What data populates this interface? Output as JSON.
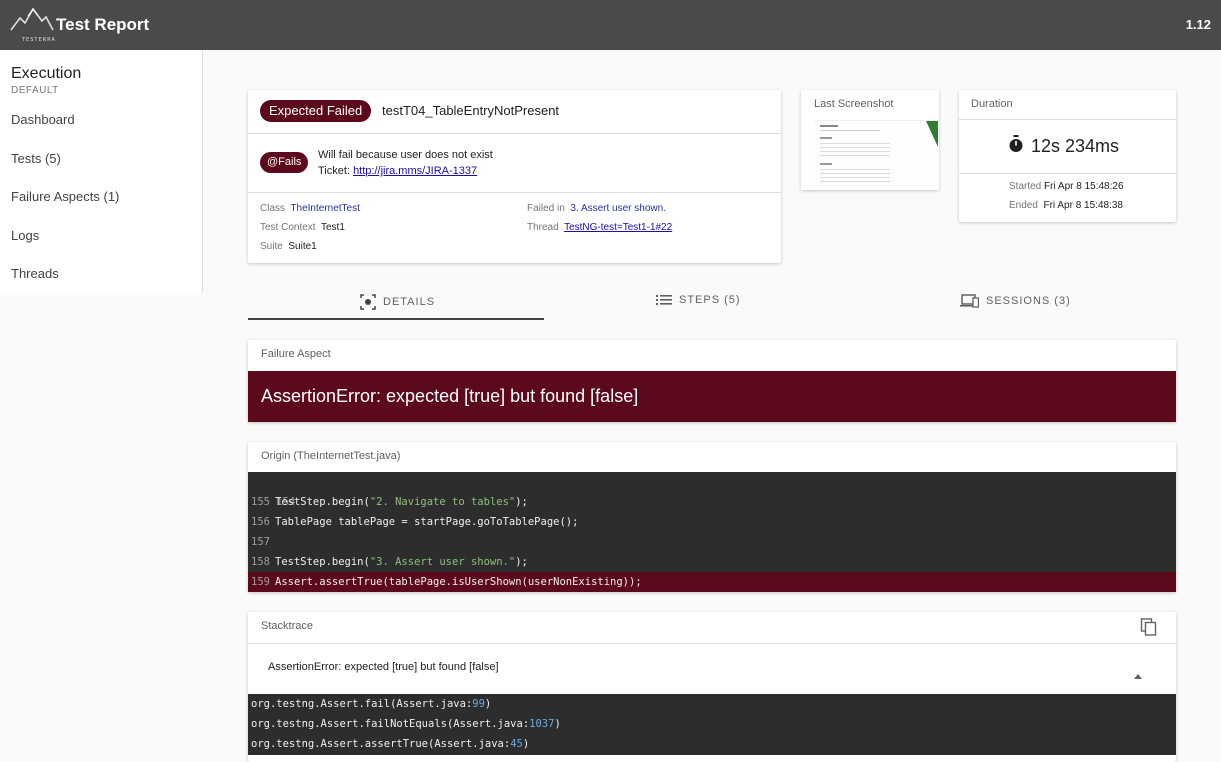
{
  "header": {
    "title": "Test Report",
    "logo_text": "TESTERRA",
    "version": "1.12"
  },
  "sidebar": {
    "title": "Execution",
    "subtitle": "DEFAULT",
    "items": [
      {
        "label": "Dashboard"
      },
      {
        "label": "Tests (5)"
      },
      {
        "label": "Failure Aspects (1)"
      },
      {
        "label": "Logs"
      },
      {
        "label": "Threads"
      }
    ]
  },
  "test": {
    "status_chip": "Expected Failed",
    "name": "testT04_TableEntryNotPresent",
    "fails_chip": "@Fails",
    "fails_description": "Will fail because user does not exist",
    "ticket_label": "Ticket:",
    "ticket_link": "http://jira.mms/JIRA-1337",
    "class_label": "Class",
    "class_value": "TheInternetTest",
    "context_label": "Test Context",
    "context_value": "Test1",
    "suite_label": "Suite",
    "suite_value": "Suite1",
    "failed_in_label": "Failed in",
    "failed_in_value": "3. Assert user shown.",
    "thread_label": "Thread",
    "thread_value": "TestNG-test=Test1-1#22"
  },
  "screenshot": {
    "label": "Last Screenshot"
  },
  "duration": {
    "label": "Duration",
    "value": "12s 234ms",
    "started_label": "Started",
    "started_value": "Fri Apr 8 15:48:26",
    "ended_label": "Ended",
    "ended_value": "Fri Apr 8 15:48:38"
  },
  "tabs": [
    {
      "label": "DETAILS",
      "icon": "details-icon",
      "active": true
    },
    {
      "label": "STEPS (5)",
      "icon": "list-icon",
      "active": false
    },
    {
      "label": "SESSIONS (3)",
      "icon": "devices-icon",
      "active": false
    }
  ],
  "failure_aspect": {
    "label": "Failure Aspect",
    "message": "AssertionError: expected [true] but found [false]",
    "accent_color": "#5c0a1b"
  },
  "origin": {
    "label": "Origin (TheInternetTest.java)",
    "lines": [
      {
        "num": "154",
        "pre": "",
        "str": "",
        "post": ""
      },
      {
        "num": "155",
        "pre": "TestStep.begin(",
        "str": "\"2. Navigate to tables\"",
        "post": ");"
      },
      {
        "num": "156",
        "pre": "TablePage tablePage = startPage.goToTablePage();",
        "str": "",
        "post": ""
      },
      {
        "num": "157",
        "pre": "",
        "str": "",
        "post": ""
      },
      {
        "num": "158",
        "pre": "TestStep.begin(",
        "str": "\"3. Assert user shown.\"",
        "post": ");"
      },
      {
        "num": "159",
        "pre": "Assert.assertTrue(tablePage.isUserShown(userNonExisting));",
        "str": "",
        "post": ""
      }
    ]
  },
  "stacktrace": {
    "label": "Stacktrace",
    "summary": "AssertionError: expected [true] but found [false]",
    "frames": [
      {
        "pre": "org.testng.Assert.fail(Assert.java:",
        "num": "99",
        "post": ")"
      },
      {
        "pre": "org.testng.Assert.failNotEquals(Assert.java:",
        "num": "1037",
        "post": ")"
      },
      {
        "pre": "org.testng.Assert.assertTrue(Assert.java:",
        "num": "45",
        "post": ")"
      }
    ]
  }
}
